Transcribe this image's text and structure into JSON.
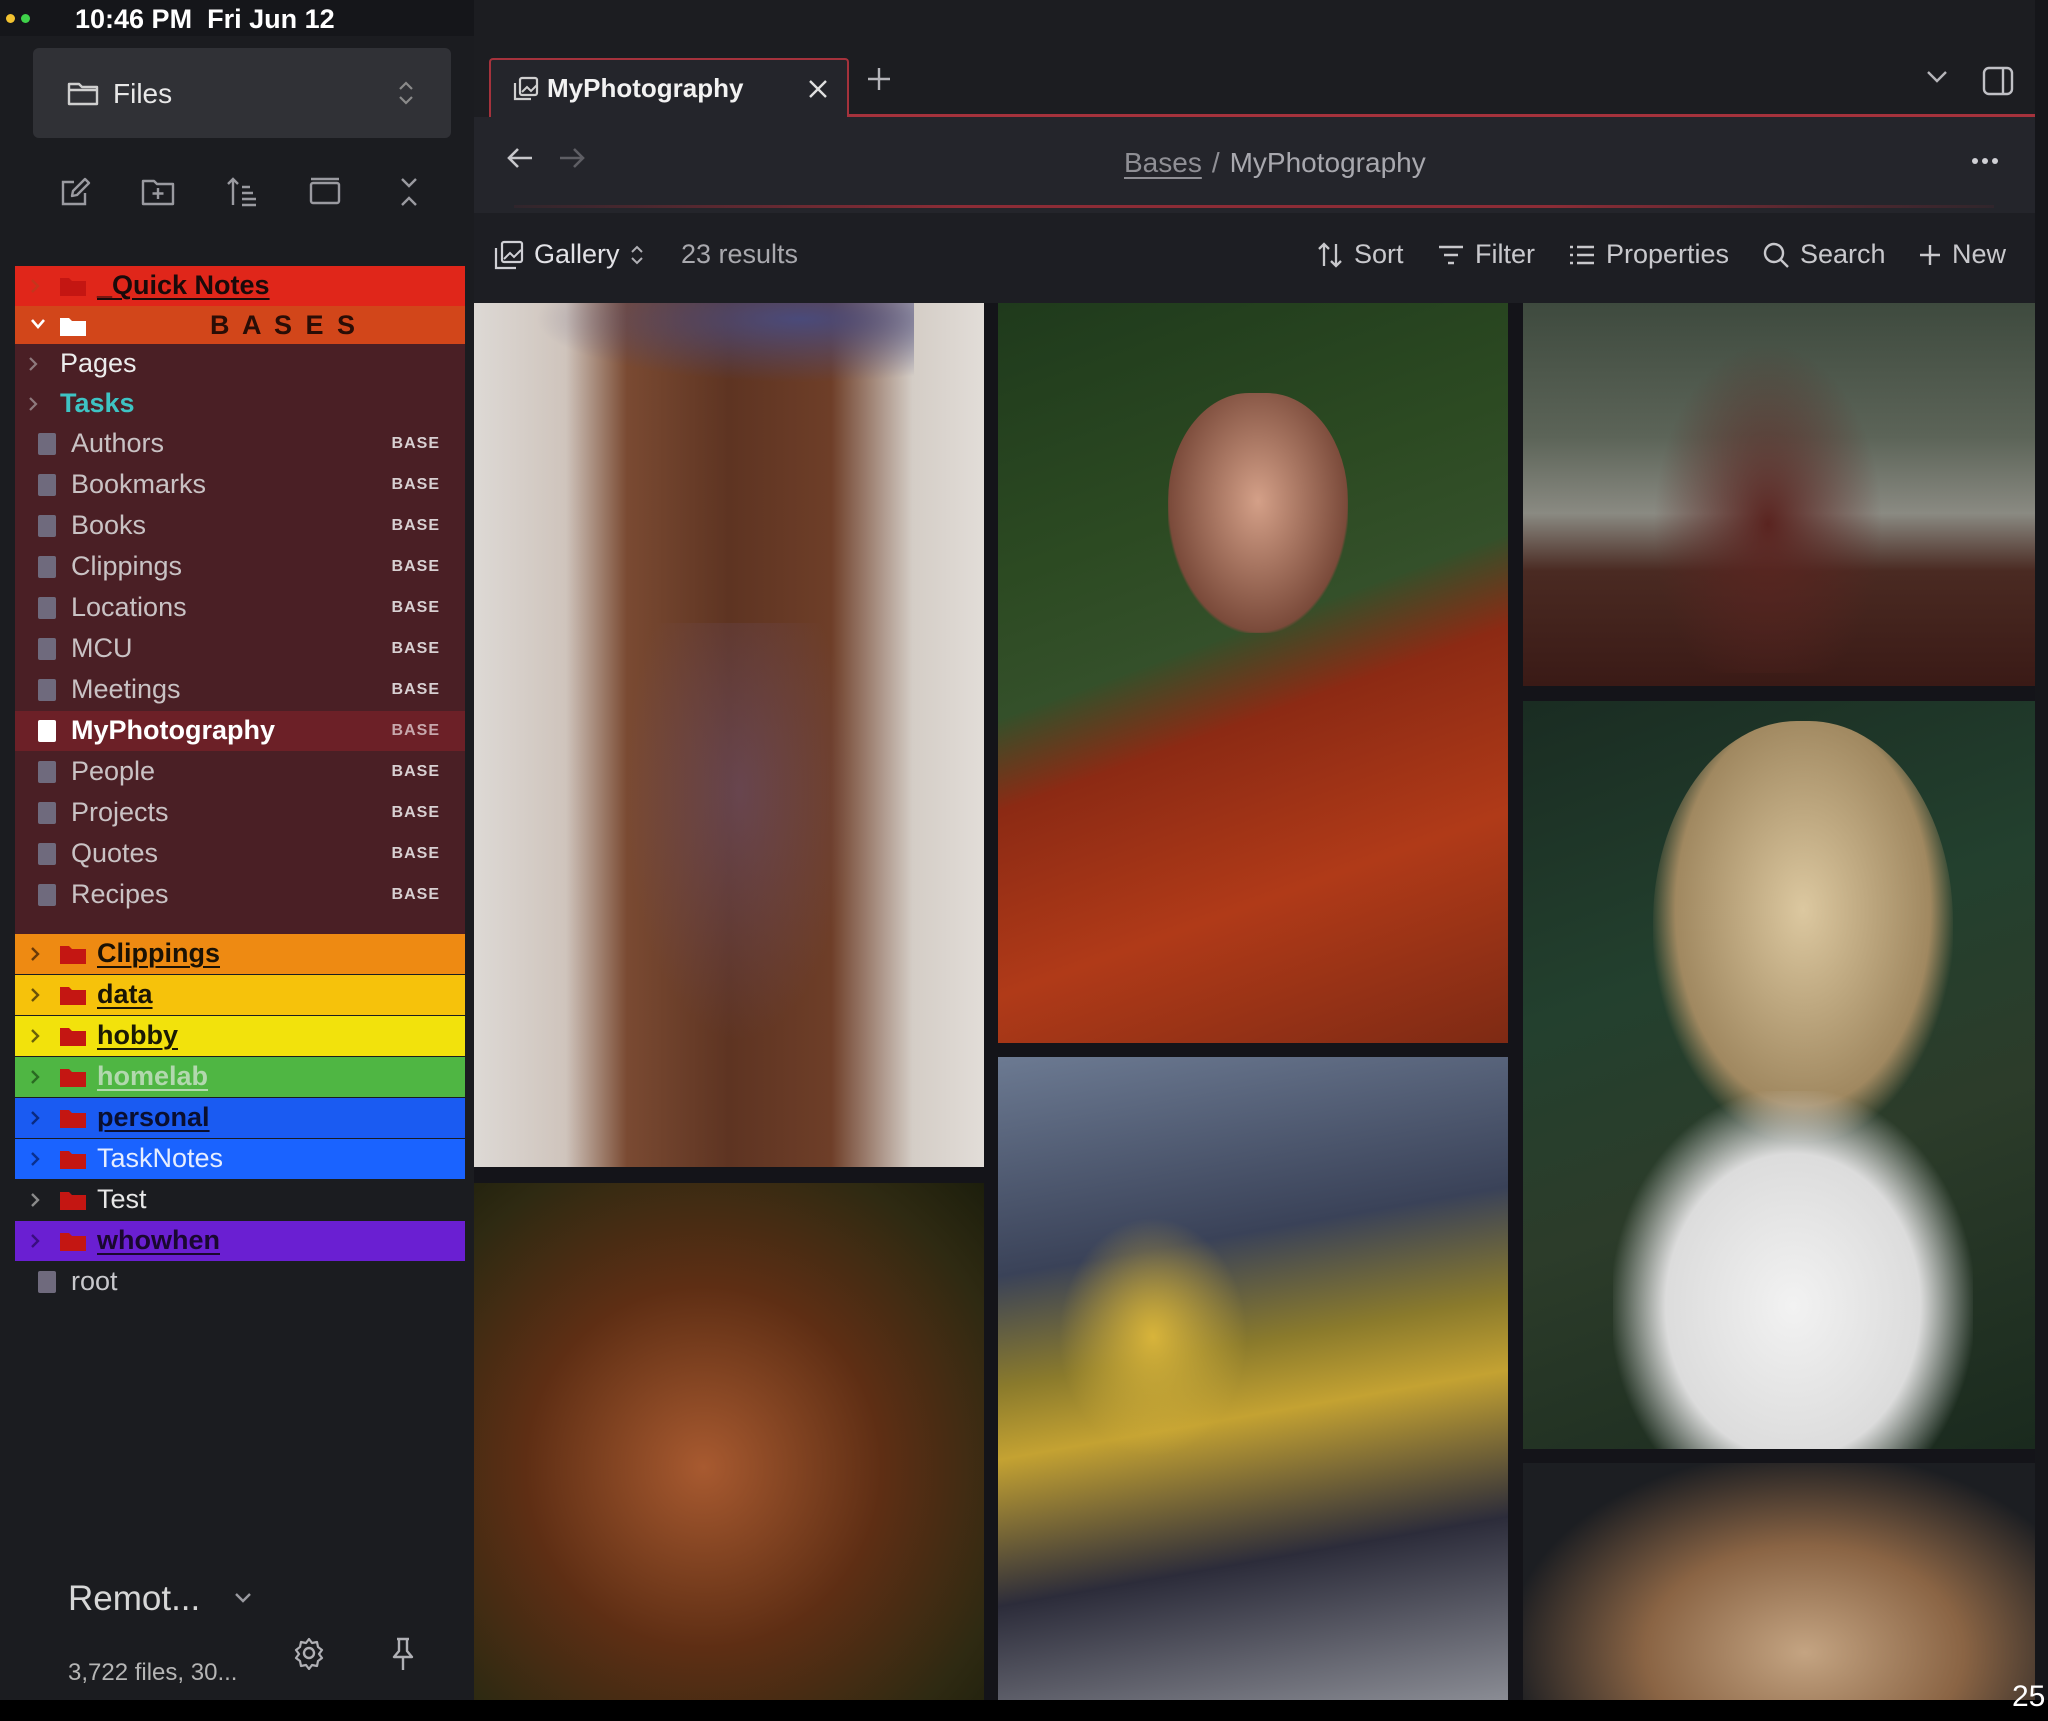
{
  "status_bar": {
    "time": "10:46 PM",
    "date": "Fri Jun 12"
  },
  "sidebar": {
    "switcher_label": "Files",
    "folders_top": [
      {
        "label": "_Quick Notes",
        "color": "#e0261a",
        "text_color": "#1a0a0a",
        "expanded": false
      },
      {
        "label": "B A S E S",
        "color": "#d2461a",
        "text_color": "#2a0d06",
        "expanded": true
      }
    ],
    "bases_items": [
      {
        "label": "Pages",
        "kind": "folder",
        "color": "#ececec"
      },
      {
        "label": "Tasks",
        "kind": "folder",
        "color": "#3ec4c4"
      },
      {
        "label": "Authors",
        "kind": "base",
        "badge": "BASE"
      },
      {
        "label": "Bookmarks",
        "kind": "base",
        "badge": "BASE"
      },
      {
        "label": "Books",
        "kind": "base",
        "badge": "BASE"
      },
      {
        "label": "Clippings",
        "kind": "base",
        "badge": "BASE"
      },
      {
        "label": "Locations",
        "kind": "base",
        "badge": "BASE"
      },
      {
        "label": "MCU",
        "kind": "base",
        "badge": "BASE"
      },
      {
        "label": "Meetings",
        "kind": "base",
        "badge": "BASE"
      },
      {
        "label": "MyPhotography",
        "kind": "base",
        "badge": "BASE",
        "active": true
      },
      {
        "label": "People",
        "kind": "base",
        "badge": "BASE"
      },
      {
        "label": "Projects",
        "kind": "base",
        "badge": "BASE"
      },
      {
        "label": "Quotes",
        "kind": "base",
        "badge": "BASE"
      },
      {
        "label": "Recipes",
        "kind": "base",
        "badge": "BASE"
      }
    ],
    "folders_bottom": [
      {
        "label": "Clippings",
        "color": "#ee8a12",
        "text_color": "#1a1205"
      },
      {
        "label": "data",
        "color": "#f6c20b",
        "text_color": "#1a1505"
      },
      {
        "label": "hobby",
        "color": "#f2e20c",
        "text_color": "#1a1a05"
      },
      {
        "label": "homelab",
        "color": "#4fb643",
        "text_color": "#b2d8ae"
      },
      {
        "label": "personal",
        "color": "#1a5bf2",
        "text_color": "#0a0f30"
      },
      {
        "label": "TaskNotes",
        "color": "#1a63ff",
        "text_color": "#e6edff"
      },
      {
        "label": "Test",
        "color": "transparent",
        "text_color": "#e8e8e8"
      },
      {
        "label": "whowhen",
        "color": "#6a1fd2",
        "text_color": "#1a0830"
      }
    ],
    "root_file": "root",
    "vault_name": "Remot...",
    "vault_stats": "3,722 files, 30..."
  },
  "tab": {
    "title": "MyPhotography"
  },
  "nav": {
    "crumb_parent": "Bases",
    "crumb_separator": "/",
    "crumb_current": "MyPhotography"
  },
  "toolbar": {
    "view_label": "Gallery",
    "results": "23 results",
    "sort": "Sort",
    "filter": "Filter",
    "properties": "Properties",
    "search": "Search",
    "new": "New"
  },
  "corner_number": "25",
  "colors": {
    "accent": "#a5323c",
    "bases_bg": "#4a1f25",
    "active_row": "#6c2027"
  }
}
